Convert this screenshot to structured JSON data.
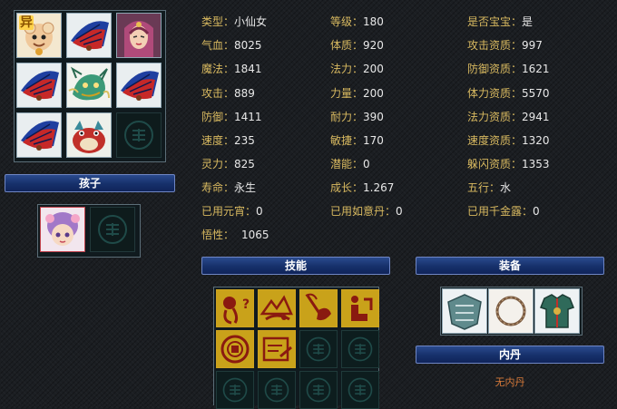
{
  "stats": [
    {
      "key": "类型：",
      "value": "小仙女"
    },
    {
      "key": "等级：",
      "value": "180"
    },
    {
      "key": "是否宝宝：",
      "value": "是"
    },
    {
      "key": "气血：",
      "value": "8025"
    },
    {
      "key": "体质：",
      "value": "920"
    },
    {
      "key": "攻击资质：",
      "value": "997"
    },
    {
      "key": "魔法：",
      "value": "1841"
    },
    {
      "key": "法力：",
      "value": "200"
    },
    {
      "key": "防御资质：",
      "value": "1621"
    },
    {
      "key": "攻击：",
      "value": "889"
    },
    {
      "key": "力量：",
      "value": "200"
    },
    {
      "key": "体力资质：",
      "value": "5570"
    },
    {
      "key": "防御：",
      "value": "1411"
    },
    {
      "key": "耐力：",
      "value": "390"
    },
    {
      "key": "法力资质：",
      "value": "2941"
    },
    {
      "key": "速度：",
      "value": "235"
    },
    {
      "key": "敏捷：",
      "value": "170"
    },
    {
      "key": "速度资质：",
      "value": "1320"
    },
    {
      "key": "灵力：",
      "value": "825"
    },
    {
      "key": "潜能：",
      "value": "0"
    },
    {
      "key": "躲闪资质：",
      "value": "1353"
    },
    {
      "key": "寿命：",
      "value": "永生"
    },
    {
      "key": "成长：",
      "value": "1.267"
    },
    {
      "key": "五行：",
      "value": "水"
    },
    {
      "key": "已用元宵：",
      "value": "0"
    },
    {
      "key": "已用如意丹：",
      "value": "0"
    },
    {
      "key": "已用千金露：",
      "value": "0"
    },
    {
      "key": "悟性：",
      "value": "1065"
    }
  ],
  "pet_grid": {
    "badge": "异",
    "slots": [
      "dragon-pet-icon",
      "fan-pet-icon",
      "fairy-woman-pet-icon",
      "fan-pet-icon",
      "qilin-dragon-pet-icon",
      "fan-pet-icon",
      "fan-pet-icon",
      "fire-beast-pet-icon",
      "empty-slot-icon"
    ]
  },
  "children_label": "孩子",
  "children": [
    "child-girl-icon",
    "empty-slot-icon"
  ],
  "skills_label": "技能",
  "equipment_label": "装备",
  "neidan_label": "内丹",
  "neidan_empty": "无内丹",
  "equipment": [
    "armor-plate-icon",
    "thorn-collar-icon",
    "robe-armor-icon"
  ],
  "skills": [
    "skill-heart-icon",
    "skill-mountain-icon",
    "skill-lotus-icon",
    "skill-kneel-icon",
    "skill-coin-icon",
    "skill-scroll-icon"
  ],
  "colors": {
    "label": "#d8b960",
    "value": "#e8e8e8",
    "banner": "#16306a",
    "neidan_empty": "#d77a3a"
  }
}
